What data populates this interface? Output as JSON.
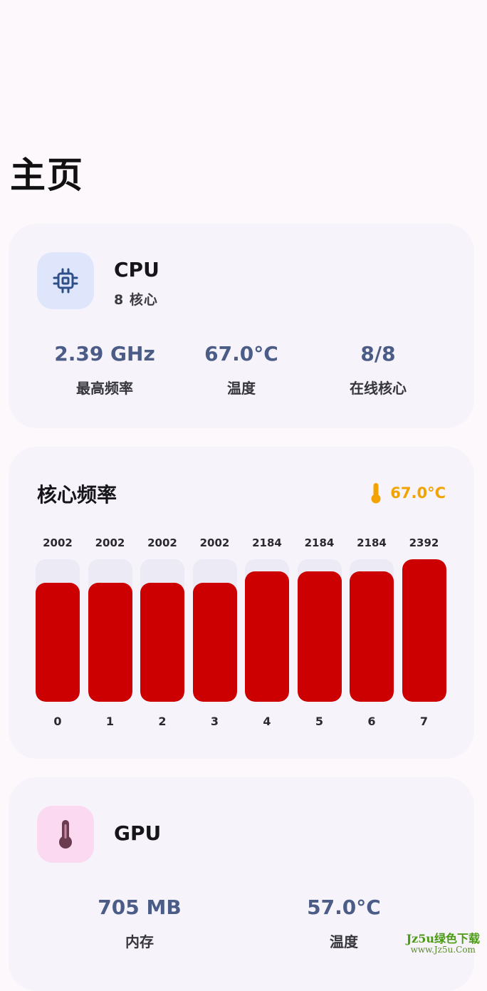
{
  "page": {
    "title": "主页"
  },
  "cpu": {
    "icon": "cpu-chip-icon",
    "title": "CPU",
    "subtitle": "8 核心",
    "stats": [
      {
        "value": "2.39 GHz",
        "label": "最高频率"
      },
      {
        "value": "67.0°C",
        "label": "温度"
      },
      {
        "value": "8/8",
        "label": "在线核心"
      }
    ]
  },
  "core_frequency": {
    "title": "核心频率",
    "temperature": "67.0°C",
    "temperature_icon": "thermometer-icon",
    "bar_color": "#cc0000",
    "chart_data": {
      "type": "bar",
      "categories": [
        "0",
        "1",
        "2",
        "3",
        "4",
        "5",
        "6",
        "7"
      ],
      "values": [
        2002,
        2002,
        2002,
        2002,
        2184,
        2184,
        2184,
        2392
      ],
      "value_labels": [
        "2002",
        "2002",
        "2002",
        "2002",
        "2184",
        "2184",
        "2184",
        "2392"
      ],
      "ylim": [
        0,
        2392
      ]
    }
  },
  "gpu": {
    "icon": "thermometer-icon",
    "title": "GPU",
    "stats": [
      {
        "value": "705 MB",
        "label": "内存"
      },
      {
        "value": "57.0°C",
        "label": "温度"
      }
    ]
  },
  "watermark": {
    "main": "Jz5u绿色下载",
    "url": "www.Jz5u.Com"
  }
}
